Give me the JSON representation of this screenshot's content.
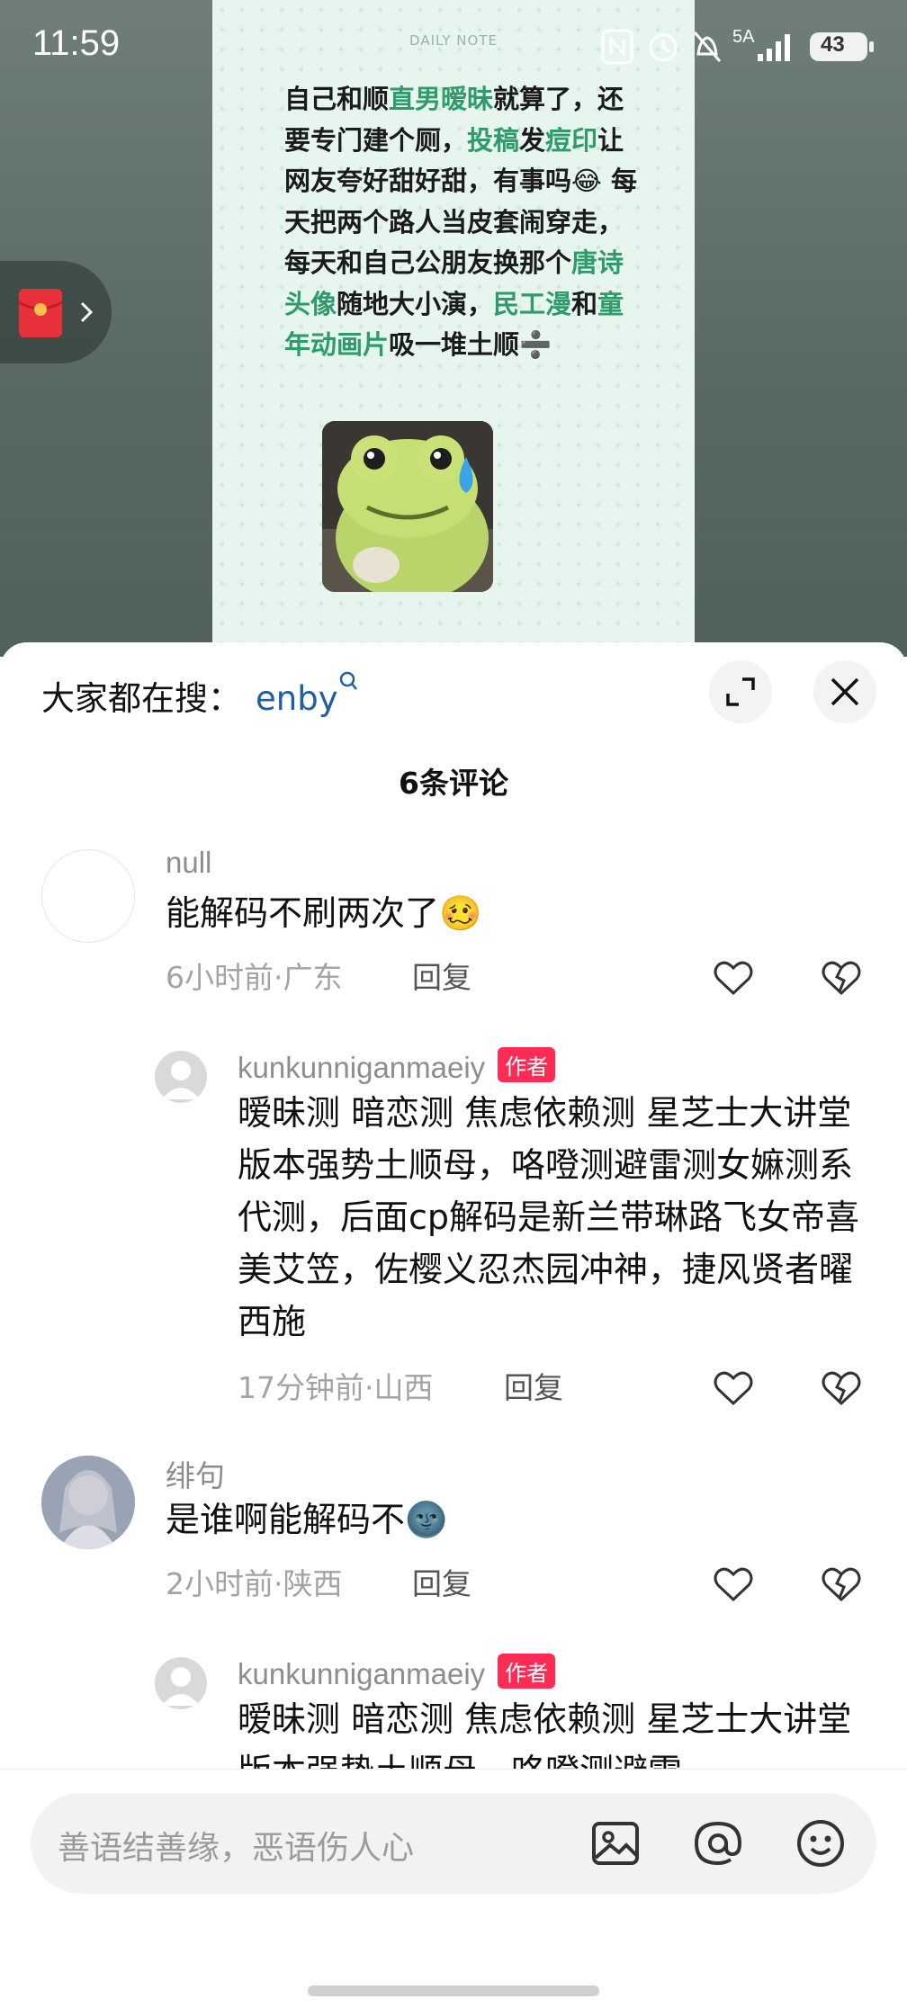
{
  "status_bar": {
    "time": "11:59",
    "network": "5A",
    "battery": "43"
  },
  "note": {
    "header": "DAILY NOTE",
    "segments": [
      {
        "t": "自己和顺",
        "hl": false
      },
      {
        "t": "直男暧昧",
        "hl": true
      },
      {
        "t": "就算了，还要专门建个厕，",
        "hl": false
      },
      {
        "t": "投稿",
        "hl": true
      },
      {
        "t": "发",
        "hl": false
      },
      {
        "t": "痘印",
        "hl": true
      },
      {
        "t": "让网友夸好甜好甜，有事吗😂      每天把两个路人当皮套闹穿走，每天和自己公朋友换那个",
        "hl": false
      },
      {
        "t": "唐诗头像",
        "hl": true
      },
      {
        "t": "随地大小演，",
        "hl": false
      },
      {
        "t": "民工漫",
        "hl": true
      },
      {
        "t": "和",
        "hl": false
      },
      {
        "t": "童年动画片",
        "hl": true
      },
      {
        "t": "吸一堆土顺➗",
        "hl": false
      }
    ]
  },
  "sheet": {
    "search_label": "大家都在搜：",
    "search_term": "enby",
    "comment_count": "6条评论"
  },
  "comments": [
    {
      "user": "null",
      "text": "能解码不刷两次了🥴",
      "meta": "6小时前·广东",
      "reply": "回复"
    },
    {
      "user": "kunkunniganmaeiy",
      "badge": "作者",
      "text": "暧昧测 暗恋测 焦虑依赖测 星芝士大讲堂 版本强势土顺母，咯噔测避雷测女嫲测系代测，后面cp解码是新兰带琳路飞女帝喜美艾笠，佐樱义忍杰园冲神，捷风贤者曜西施",
      "meta": "17分钟前·山西",
      "reply": "回复"
    },
    {
      "user": "绯句",
      "text": "是谁啊能解码不🌚",
      "meta": "2小时前·陕西",
      "reply": "回复"
    },
    {
      "user": "kunkunniganmaeiy",
      "badge": "作者",
      "text": "暧昧测 暗恋测 焦虑依赖测 星芝士大讲堂 版本强势土顺母，咯噔测避雷"
    }
  ],
  "input": {
    "placeholder": "善语结善缘，恶语伤人心"
  },
  "icons": {
    "status": [
      "nfc-icon",
      "alarm-icon",
      "mute-icon",
      "signal-icon",
      "battery-icon"
    ],
    "sheet": [
      "expand-icon",
      "close-icon",
      "like-icon",
      "dislike-icon"
    ],
    "input": [
      "image-icon",
      "at-icon",
      "emoji-icon"
    ]
  }
}
